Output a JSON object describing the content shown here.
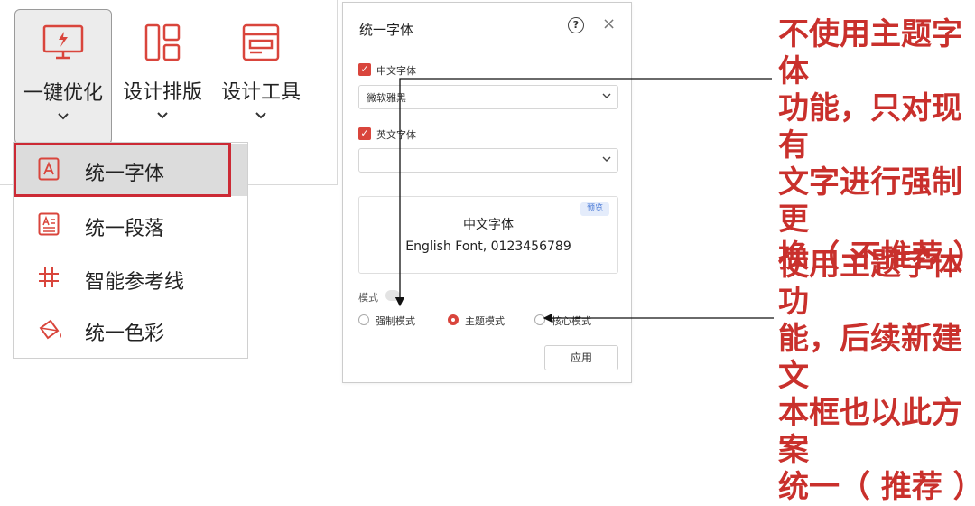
{
  "ribbon": {
    "buttons": [
      {
        "label": "一键优化",
        "icon": "monitor-lightning-icon"
      },
      {
        "label": "设计排版",
        "icon": "layout-grid-icon"
      },
      {
        "label": "设计工具",
        "icon": "tool-window-icon"
      }
    ]
  },
  "menu": {
    "items": [
      {
        "label": "统一字体",
        "icon": "font-a-icon"
      },
      {
        "label": "统一段落",
        "icon": "paragraph-icon"
      },
      {
        "label": "智能参考线",
        "icon": "hashtag-guides-icon"
      },
      {
        "label": "统一色彩",
        "icon": "paint-bucket-icon"
      }
    ]
  },
  "dialog": {
    "title": "统一字体",
    "help": "?",
    "close": "×",
    "cn_font": {
      "label": "中文字体",
      "checked": true,
      "value": "微软雅黑"
    },
    "en_font": {
      "label": "英文字体",
      "checked": true,
      "value": ""
    },
    "preview": {
      "badge": "预览",
      "cn_text": "中文字体",
      "en_text": "English Font, 0123456789"
    },
    "mode_label": "模式",
    "modes": [
      "强制模式",
      "主题模式",
      "核心模式"
    ],
    "apply": "应用"
  },
  "annotations": {
    "top": [
      "不使用主题字体",
      "功能，只对现有",
      "文字进行强制更",
      "换（ 不推荐 ）"
    ],
    "bottom": [
      "使用主题字体功",
      "能，后续新建文",
      "本框也以此方案",
      "统一（ 推荐 ）"
    ]
  },
  "colors": {
    "accent": "#d9453c",
    "annotation": "#c9302c",
    "highlight_border": "#cc2a35"
  }
}
